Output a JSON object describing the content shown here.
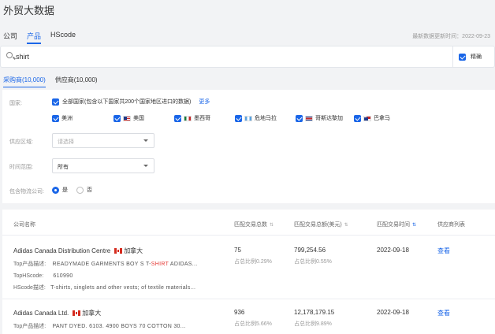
{
  "app": {
    "title": "外贸大数据"
  },
  "main_tabs": [
    {
      "label": "公司",
      "active": false
    },
    {
      "label": "产品",
      "active": true
    },
    {
      "label": "HScode",
      "active": false
    }
  ],
  "update_info": "最新数据更新时间：2022-09-23",
  "search": {
    "value": "shirt",
    "precise_label": "精确",
    "precise_checked": true
  },
  "sub_tabs": [
    {
      "label": "采购商(10,000)",
      "active": true
    },
    {
      "label": "供应商(10,000)",
      "active": false
    }
  ],
  "filters": {
    "country_label": "国家:",
    "all_countries": "全部国家(包含以下国家共200个国家地区进口的数据)",
    "more": "更多",
    "countries": [
      "美洲",
      "美国",
      "墨西哥",
      "危地马拉",
      "哥斯达黎加",
      "巴拿马"
    ],
    "region_label": "供应区域:",
    "region_placeholder": "请选择",
    "time_label": "时间范围:",
    "time_value": "所有",
    "logistics_label": "包含物流公司:",
    "yes": "是",
    "no": "否",
    "logistics_selected": "yes"
  },
  "table": {
    "headers": [
      "公司名称",
      "匹配交易总数",
      "匹配交易总额(美元)",
      "匹配交易时间",
      "供应商列表"
    ],
    "rows": [
      {
        "company": "Adidas Canada Distribution Centre",
        "country": "加拿大",
        "product_label": "Top产品描述:",
        "product_pre": "READYMADE GARMENTS BOY S T-",
        "product_hl": "SHIRT",
        "product_post": " ADIDAS...",
        "hscode_label": "TopHScode:",
        "hscode": "610990",
        "hsdesc_label": "HScode描述:",
        "hsdesc": "T-shirts, singlets and other vests; of textile materials...",
        "count": "75",
        "count_ratio": "占总比例0.29%",
        "amount": "799,254.56",
        "amount_ratio": "占总比例0.55%",
        "date": "2022-09-18",
        "action": "查看"
      },
      {
        "company": "Adidas Canada Ltd.",
        "country": "加拿大",
        "product_label": "Top产品描述:",
        "product_pre": "PANT DYED. 6103. 4900 BOYS 70 COTTON 30...",
        "product_hl": "",
        "product_post": "",
        "count": "936",
        "count_ratio": "占总比例5.66%",
        "amount": "12,178,179.15",
        "amount_ratio": "占总比例9.89%",
        "date": "2022-09-18",
        "action": "查看"
      }
    ]
  }
}
